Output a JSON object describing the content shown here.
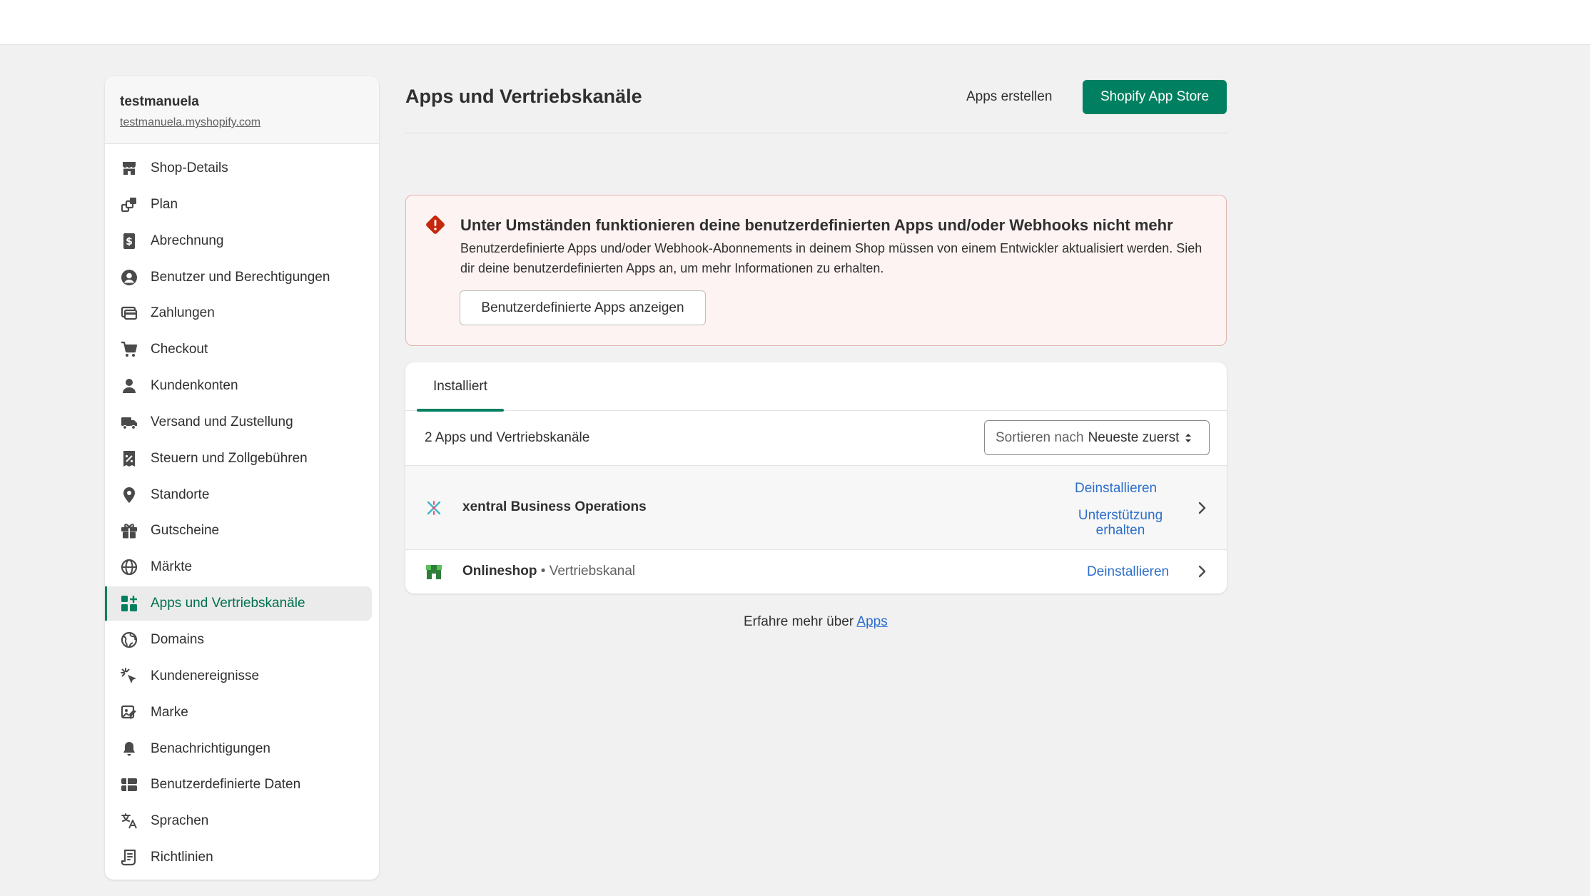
{
  "shop": {
    "name": "testmanuela",
    "url": "testmanuela.myshopify.com"
  },
  "nav": {
    "items": [
      {
        "label": "Shop-Details",
        "icon": "store-icon"
      },
      {
        "label": "Plan",
        "icon": "plan-icon"
      },
      {
        "label": "Abrechnung",
        "icon": "billing-icon"
      },
      {
        "label": "Benutzer und Berechtigungen",
        "icon": "user-circle-icon"
      },
      {
        "label": "Zahlungen",
        "icon": "payments-icon"
      },
      {
        "label": "Checkout",
        "icon": "cart-icon"
      },
      {
        "label": "Kundenkonten",
        "icon": "person-icon"
      },
      {
        "label": "Versand und Zustellung",
        "icon": "truck-icon"
      },
      {
        "label": "Steuern und Zollgebühren",
        "icon": "tax-icon"
      },
      {
        "label": "Standorte",
        "icon": "location-icon"
      },
      {
        "label": "Gutscheine",
        "icon": "gift-icon"
      },
      {
        "label": "Märkte",
        "icon": "globe-icon"
      },
      {
        "label": "Apps und Vertriebskanäle",
        "icon": "apps-icon",
        "active": true
      },
      {
        "label": "Domains",
        "icon": "domains-icon"
      },
      {
        "label": "Kundenereignisse",
        "icon": "cursor-click-icon"
      },
      {
        "label": "Marke",
        "icon": "brand-icon"
      },
      {
        "label": "Benachrichtigungen",
        "icon": "bell-icon"
      },
      {
        "label": "Benutzerdefinierte Daten",
        "icon": "metafields-icon"
      },
      {
        "label": "Sprachen",
        "icon": "translate-icon"
      },
      {
        "label": "Richtlinien",
        "icon": "policy-icon"
      }
    ]
  },
  "header": {
    "title": "Apps und Vertriebskanäle",
    "create_apps_label": "Apps erstellen",
    "app_store_label": "Shopify App Store"
  },
  "banner": {
    "title": "Unter Umständen funktionieren deine benutzerdefinierten Apps und/oder Webhooks nicht mehr",
    "text": "Benutzerdefinierte Apps und/oder Webhook-Abonnements in deinem Shop müssen von einem Entwickler aktualisiert werden. Sieh dir deine benutzerdefinierten Apps an, um mehr Informationen zu erhalten.",
    "button_label": "Benutzerdefinierte Apps anzeigen"
  },
  "apps": {
    "tab_label": "Installiert",
    "count_label": "2 Apps und Vertriebskanäle",
    "sort_prefix": "Sortieren nach",
    "sort_value": "Neueste zuerst",
    "rows": [
      {
        "name": "xentral Business Operations",
        "meta": "",
        "uninstall_label": "Deinstallieren",
        "support_label_1": "Unterstützung",
        "support_label_2": "erhalten"
      },
      {
        "name": "Onlineshop",
        "meta": "• Vertriebskanal",
        "uninstall_label": "Deinstallieren"
      }
    ]
  },
  "footer": {
    "text": "Erfahre mehr über",
    "link_label": "Apps"
  },
  "colors": {
    "accent": "#008060",
    "link": "#2c6ecb",
    "critical": "#c5280c",
    "banner_bg": "#fdf3f2"
  }
}
